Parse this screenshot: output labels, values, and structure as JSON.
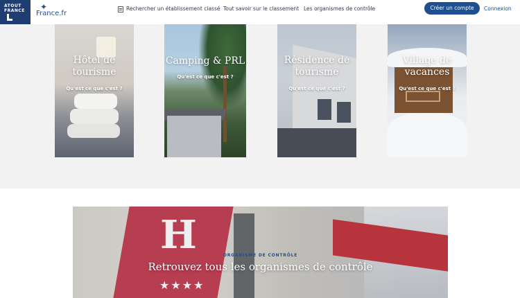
{
  "header": {
    "logo_atout_line1": "ATOUT",
    "logo_atout_line2": "FRANCE",
    "logo_france": "France.fr",
    "nav": [
      {
        "label": "Rechercher un établissement classé",
        "icon": "document-icon"
      },
      {
        "label": "Tout savoir sur le classement"
      },
      {
        "label": "Les organismes de contrôle"
      }
    ],
    "create_account": "Créer un compte",
    "login": "Connexion"
  },
  "cards": [
    {
      "title_line1": "Hôtel de",
      "title_line2": "tourisme",
      "cta": "Qu'est ce que c'est ?"
    },
    {
      "title_line1": "Camping & PRL",
      "title_line2": "",
      "cta": "Qu'est ce que c'est ?"
    },
    {
      "title_line1": "Résidence de",
      "title_line2": "tourisme",
      "cta": "Qu'est ce que c'est ?"
    },
    {
      "title_line1": "Village de",
      "title_line2": "vacances",
      "cta": "Qu'est ce que c'est ?"
    }
  ],
  "banner": {
    "sign_letter": "H",
    "stars": "★★★★",
    "kicker": "ORGANISME DE CONTRÔLE",
    "headline": "Retrouvez tous les organismes de contrôle"
  },
  "colors": {
    "brand_blue": "#1e4f8f",
    "navy": "#1e3d73",
    "grey_bg": "#f2f2f2",
    "sign_red": "#c0354b"
  }
}
